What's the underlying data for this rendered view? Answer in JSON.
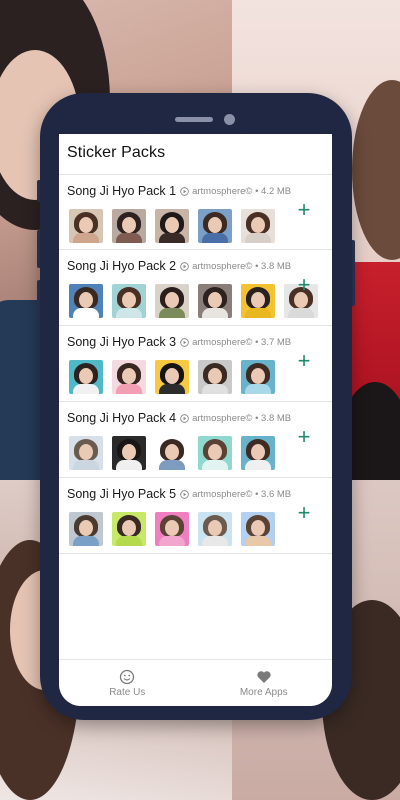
{
  "screen": {
    "title": "Sticker Packs"
  },
  "packs": [
    {
      "name": "Song Ji Hyo Pack 1",
      "publisher": "artmosphere©",
      "size": "4.2 MB",
      "add_label": "+"
    },
    {
      "name": "Song Ji Hyo Pack 2",
      "publisher": "artmosphere©",
      "size": "3.8 MB",
      "add_label": "+"
    },
    {
      "name": "Song Ji Hyo Pack 3",
      "publisher": "artmosphere©",
      "size": "3.7 MB",
      "add_label": "+"
    },
    {
      "name": "Song Ji Hyo Pack 4",
      "publisher": "artmosphere©",
      "size": "3.8 MB",
      "add_label": "+"
    },
    {
      "name": "Song Ji Hyo Pack 5",
      "publisher": "artmosphere©",
      "size": "3.6 MB",
      "add_label": "+"
    }
  ],
  "separator": "•",
  "bottom_nav": [
    {
      "label": "Rate Us",
      "icon": "smiley-icon"
    },
    {
      "label": "More Apps",
      "icon": "heart-icon"
    }
  ],
  "colors": {
    "accent": "#1f8a6d",
    "phone_frame": "#1f2743"
  }
}
